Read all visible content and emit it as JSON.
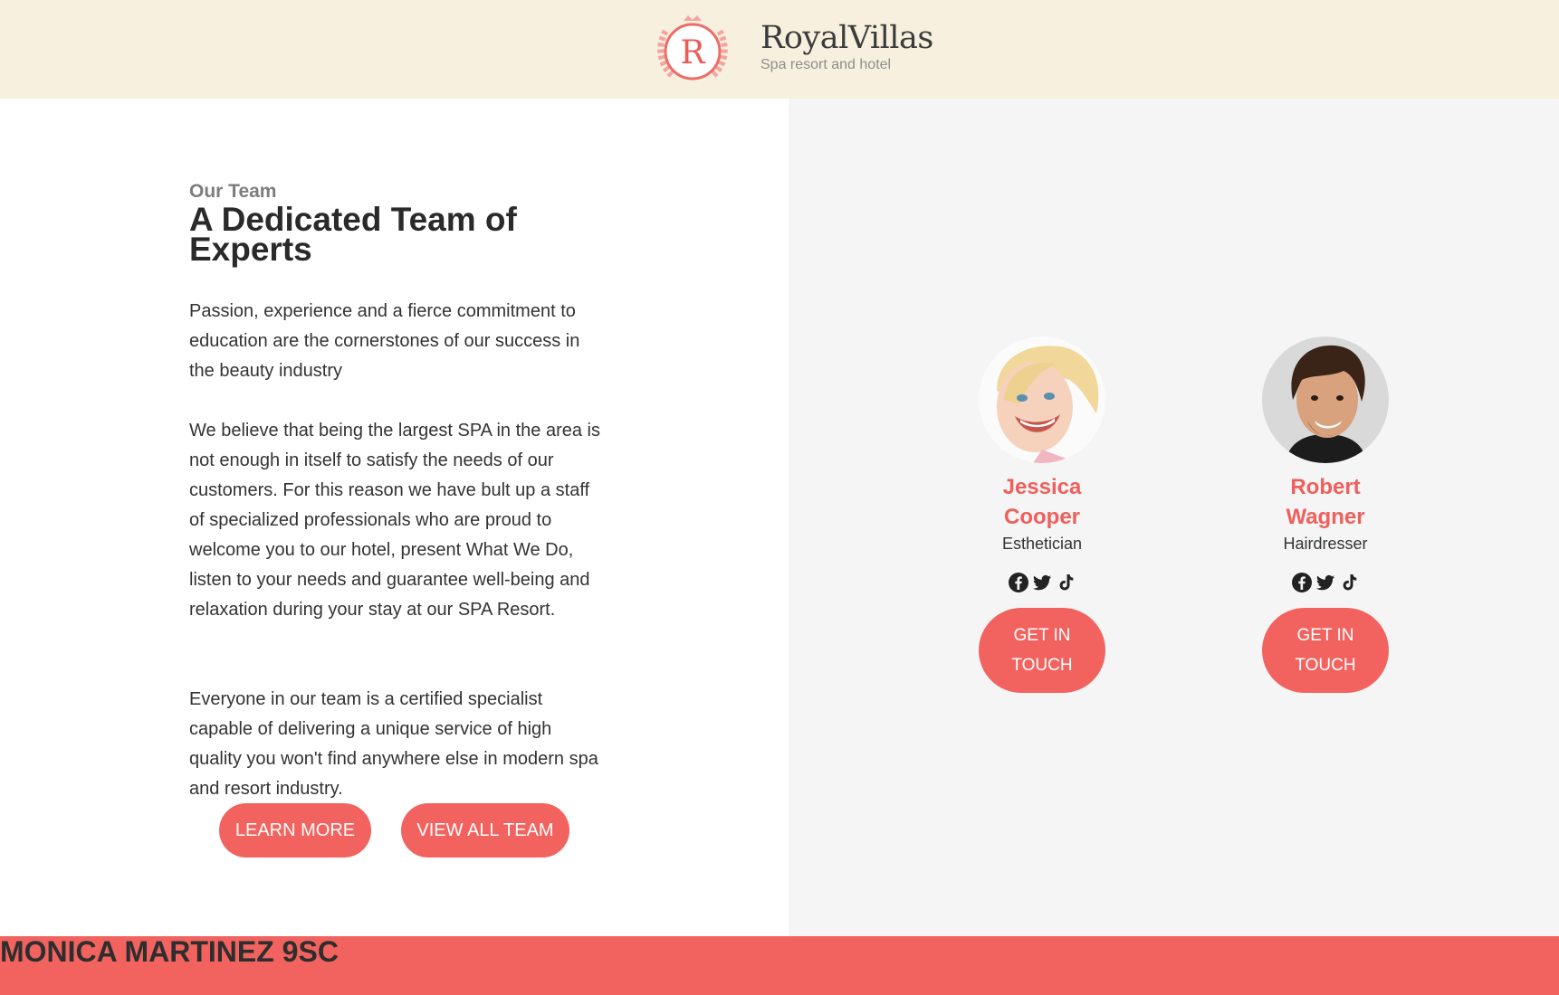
{
  "brand": {
    "logo_letter": "R",
    "name": "RoyalVillas",
    "tagline": "Spa resort and hotel"
  },
  "intro": {
    "eyebrow": "Our Team",
    "title": "A Dedicated Team of Experts",
    "paragraphs": [
      "Passion, experience and a fierce commitment to education are the cornerstones of our success in the beauty industry",
      "We believe that being the largest SPA in the area is not enough in itself to satisfy the needs of our customers. For this reason we have bult up a staff of specialized professionals who are proud to welcome you to our hotel, present What We Do, listen to your needs and guarantee well-being and relaxation during your stay at our SPA Resort.",
      "Everyone in our team is a certified specialist capable of delivering a unique service of high quality you won't find anywhere else in modern spa and resort industry."
    ],
    "learn_more_label": "LEARN MORE",
    "view_team_label": "VIEW ALL TEAM"
  },
  "team": [
    {
      "name": "Jessica Cooper",
      "role": "Esthetician",
      "cta": "GET IN TOUCH",
      "socials": [
        "facebook-icon",
        "twitter-icon",
        "tiktok-icon"
      ]
    },
    {
      "name": "Robert Wagner",
      "role": "Hairdresser",
      "cta": "GET IN TOUCH",
      "socials": [
        "facebook-icon",
        "twitter-icon",
        "tiktok-icon"
      ]
    }
  ],
  "footer": {
    "text": "MONICA MARTINEZ 9SC"
  },
  "colors": {
    "accent": "#f2635f",
    "header_bg": "#f8f0de",
    "panel_bg": "#f5f5f5"
  }
}
